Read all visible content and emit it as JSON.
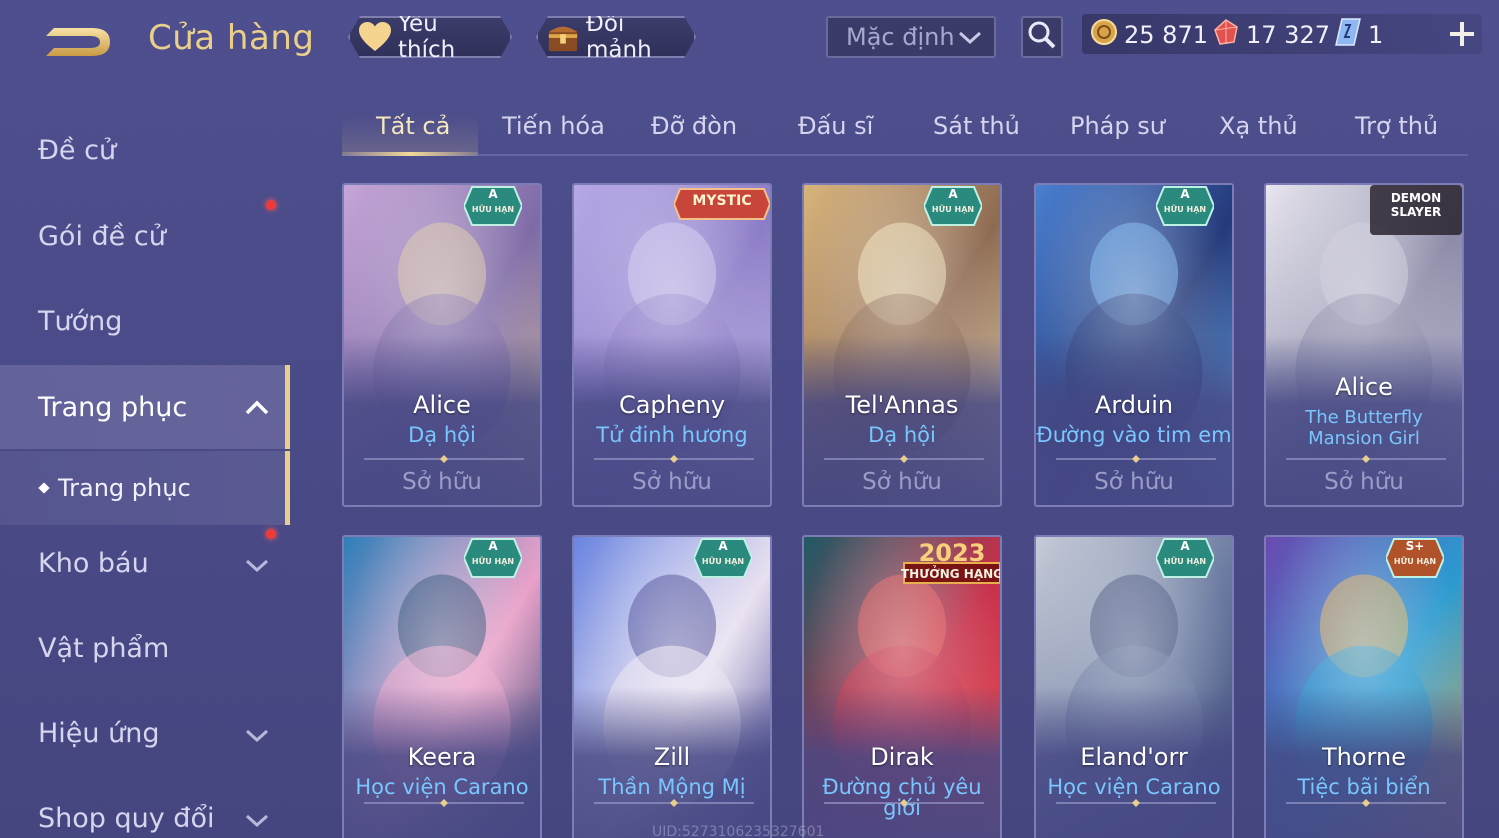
{
  "header": {
    "title": "Cửa hàng",
    "favorite_label": "Yêu thích",
    "exchange_label": "Đổi mảnh",
    "sort_value": "Mặc định"
  },
  "currencies": {
    "gold": "25 871",
    "ruby": "17 327",
    "voucher": "1"
  },
  "sidebar": {
    "items": [
      {
        "label": "Đề cử"
      },
      {
        "label": "Gói đề cử"
      },
      {
        "label": "Tướng"
      },
      {
        "label": "Trang phục"
      },
      {
        "label": "Kho báu"
      },
      {
        "label": "Vật phẩm"
      },
      {
        "label": "Hiệu ứng"
      },
      {
        "label": "Shop quy đổi"
      }
    ],
    "sub_item": "Trang phục"
  },
  "tabs": [
    "Tất cả",
    "Tiến hóa",
    "Đỡ đòn",
    "Đấu sĩ",
    "Sát thủ",
    "Pháp sư",
    "Xạ thủ",
    "Trợ thủ"
  ],
  "cards": [
    {
      "hero": "Alice",
      "skin": "Dạ hội",
      "status": "Sở hữu",
      "badge": "A",
      "badge_sub": "HỮU HẠN"
    },
    {
      "hero": "Capheny",
      "skin": "Tử đinh hương",
      "status": "Sở hữu",
      "badge": "MYSTIC"
    },
    {
      "hero": "Tel'Annas",
      "skin": "Dạ hội",
      "status": "Sở hữu",
      "badge": "A",
      "badge_sub": "HỮU HẠN"
    },
    {
      "hero": "Arduin",
      "skin": "Đường vào tim em",
      "status": "Sở hữu",
      "badge": "A",
      "badge_sub": "HỮU HẠN"
    },
    {
      "hero": "Alice",
      "skin": "The Butterfly Mansion Girl",
      "status": "Sở hữu",
      "badge": "DEMON SLAYER"
    },
    {
      "hero": "Keera",
      "skin": "Học viện Carano",
      "badge": "A",
      "badge_sub": "HỮU HẠN"
    },
    {
      "hero": "Zill",
      "skin": "Thần Mộng Mị",
      "badge": "A",
      "badge_sub": "HỮU HẠN"
    },
    {
      "hero": "Dirak",
      "skin": "Đường chủ yêu giới",
      "badge": "2023",
      "badge_sub": "THƯỞNG HẠNG"
    },
    {
      "hero": "Eland'orr",
      "skin": "Học viện Carano",
      "badge": "A",
      "badge_sub": "HỮU HẠN"
    },
    {
      "hero": "Thorne",
      "skin": "Tiệc bãi biển",
      "badge": "S+",
      "badge_sub": "HỮU HẠN"
    }
  ],
  "uid": "UID:5273106235327601",
  "colors": {
    "gold": "#e9cf8a",
    "skin_blue": "#79c6ff",
    "accent": "#e8cf8e"
  }
}
